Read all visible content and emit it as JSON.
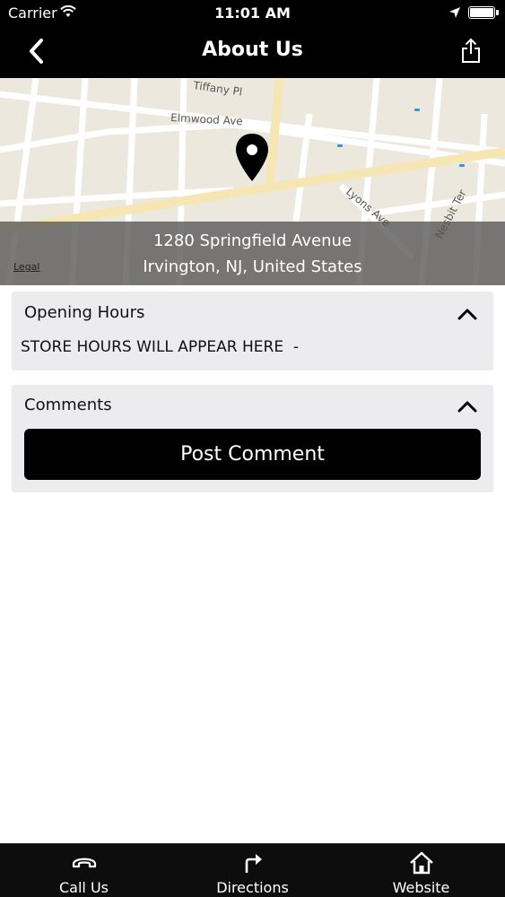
{
  "status_bar": {
    "carrier": "Carrier",
    "time": "11:01 AM"
  },
  "nav": {
    "title": "About Us",
    "back_icon": "chevron-left-icon",
    "share_icon": "share-icon"
  },
  "map": {
    "address_line1": "1280 Springfield Avenue",
    "address_line2": "Irvington, NJ, United States",
    "legal_label": "Legal",
    "street_labels": [
      "Tiffany Pl",
      "Elmwood Ave",
      "Lyons Ave",
      "Nesbit Ter"
    ]
  },
  "opening_hours": {
    "title": "Opening Hours",
    "text": "STORE HOURS WILL APPEAR HERE  -"
  },
  "comments": {
    "title": "Comments",
    "post_button": "Post Comment"
  },
  "tab_bar": {
    "items": [
      {
        "label": "Call Us",
        "icon": "phone-icon"
      },
      {
        "label": "Directions",
        "icon": "directions-icon"
      },
      {
        "label": "Website",
        "icon": "home-icon"
      }
    ]
  },
  "colors": {
    "bar_background": "#000000",
    "card_background": "#ececef",
    "map_background": "#ede8de",
    "road_major": "#f5e6b3"
  }
}
